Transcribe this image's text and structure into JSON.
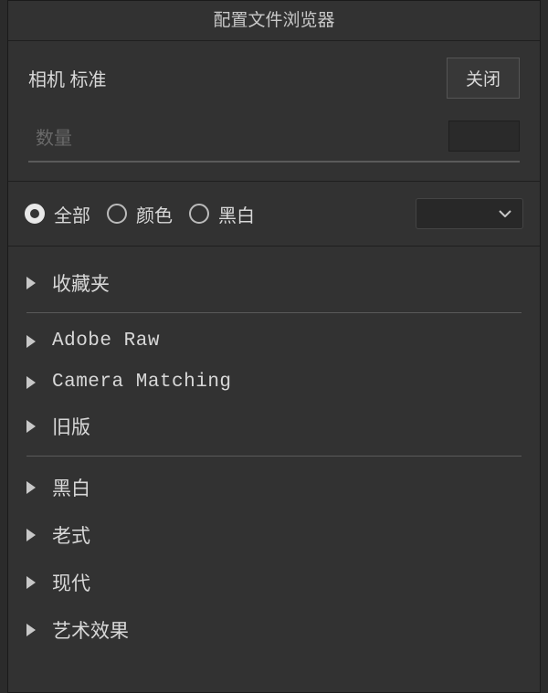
{
  "header": {
    "title": "配置文件浏览器"
  },
  "cameraSection": {
    "label": "相机 标准",
    "closeLabel": "关闭",
    "amountLabel": "数量"
  },
  "filters": {
    "options": [
      {
        "label": "全部",
        "selected": true
      },
      {
        "label": "颜色",
        "selected": false
      },
      {
        "label": "黑白",
        "selected": false
      }
    ]
  },
  "groups": [
    {
      "label": "收藏夹",
      "mono": false
    },
    {
      "divider": true
    },
    {
      "label": "Adobe Raw",
      "mono": true
    },
    {
      "label": "Camera Matching",
      "mono": true
    },
    {
      "label": "旧版",
      "mono": false
    },
    {
      "divider": true
    },
    {
      "label": "黑白",
      "mono": false
    },
    {
      "label": "老式",
      "mono": false
    },
    {
      "label": "现代",
      "mono": false
    },
    {
      "label": "艺术效果",
      "mono": false
    }
  ]
}
